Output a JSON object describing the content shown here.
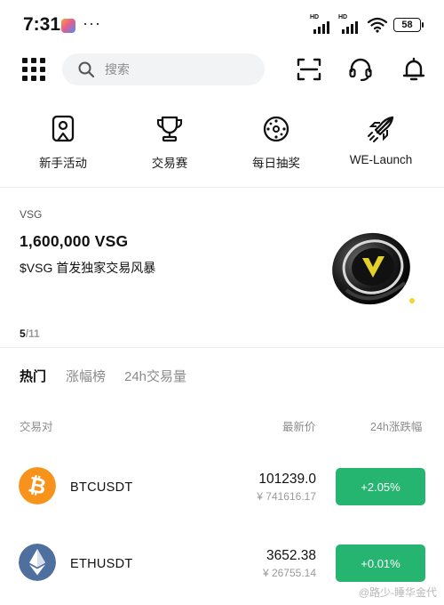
{
  "status_bar": {
    "time": "7:31",
    "more": "···",
    "battery": "58",
    "network_label": "HD"
  },
  "search": {
    "placeholder": "搜索"
  },
  "quick_actions": [
    {
      "label": "新手活动",
      "icon": "badge-icon"
    },
    {
      "label": "交易赛",
      "icon": "trophy-icon"
    },
    {
      "label": "每日抽奖",
      "icon": "lucky-wheel-icon"
    },
    {
      "label": "WE-Launch",
      "icon": "rocket-icon"
    }
  ],
  "banner": {
    "tag": "VSG",
    "title": "1,600,000  VSG",
    "subtitle": "$VSG 首发独家交易风暴",
    "page_current": "5",
    "page_total": "/11"
  },
  "tabs": [
    {
      "label": "热门",
      "active": true
    },
    {
      "label": "涨幅榜",
      "active": false
    },
    {
      "label": "24h交易量",
      "active": false
    }
  ],
  "table": {
    "col_pair": "交易对",
    "col_price": "最新价",
    "col_change": "24h涨跌幅",
    "rows": [
      {
        "pair": "BTCUSDT",
        "price": "101239.0",
        "fiat": "¥ 741616.17",
        "change": "+2.05%",
        "coin_color": "#f7931a"
      },
      {
        "pair": "ETHUSDT",
        "price": "3652.38",
        "fiat": "¥ 26755.14",
        "change": "+0.01%",
        "coin_color": "#627eea"
      }
    ]
  },
  "colors": {
    "up": "#25b571",
    "search_bg": "#f2f3f5"
  },
  "watermark": "@路少-睡华金代"
}
